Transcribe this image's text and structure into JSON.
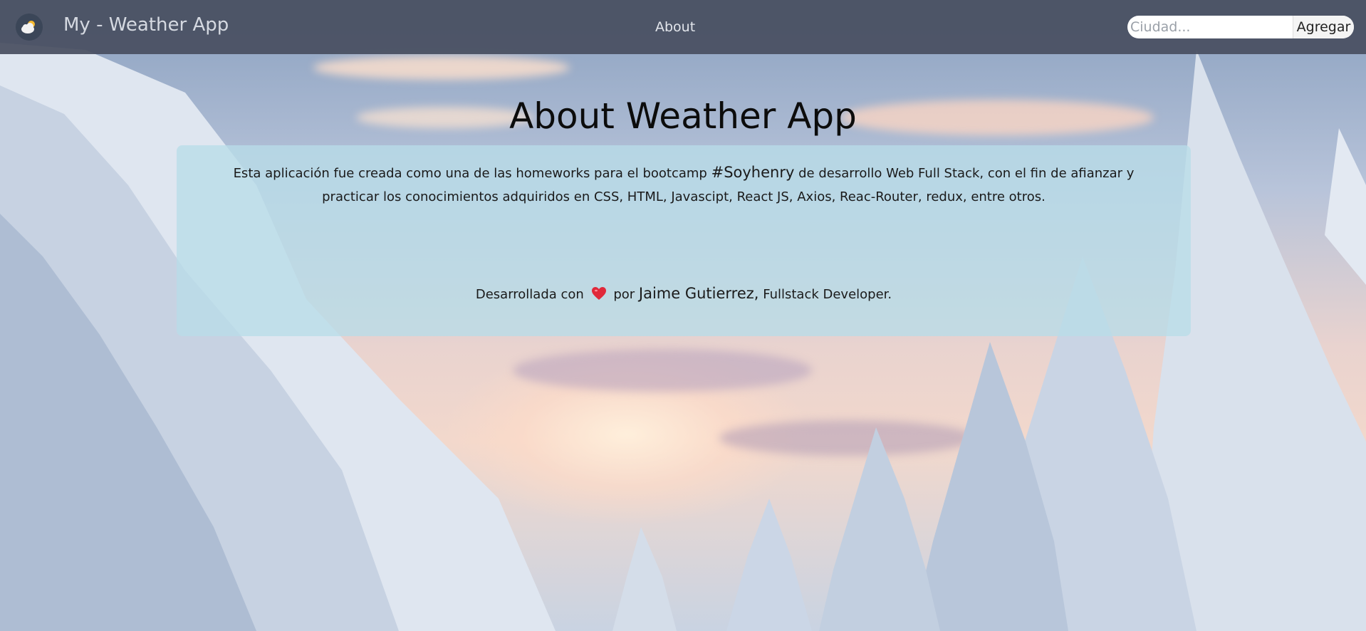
{
  "navbar": {
    "brand": "My - Weather App",
    "about_link": "About",
    "search": {
      "placeholder": "Ciudad...",
      "value": "",
      "button_label": "Agregar"
    }
  },
  "main": {
    "title": "About Weather App",
    "description_prefix": "Esta aplicación fue creada como una de las homeworks para el bootcamp ",
    "description_tag": "#Soyhenry",
    "description_suffix": " de desarrollo Web Full Stack, con el fin de afianzar y practicar los conocimientos adquiridos en CSS, HTML, Javascipt, React JS, Axios, Reac-Router, redux, entre otros.",
    "credit_prefix": "Desarrollada con",
    "credit_by": "por",
    "author": "Jaime Gutierrez,",
    "role": "Fullstack Developer."
  },
  "icons": {
    "logo": "weather-logo-icon",
    "heart": "heart-icon"
  },
  "colors": {
    "navbar_bg": "#484e60",
    "card_bg": "#b9dce8",
    "heart": "#e0283a"
  }
}
